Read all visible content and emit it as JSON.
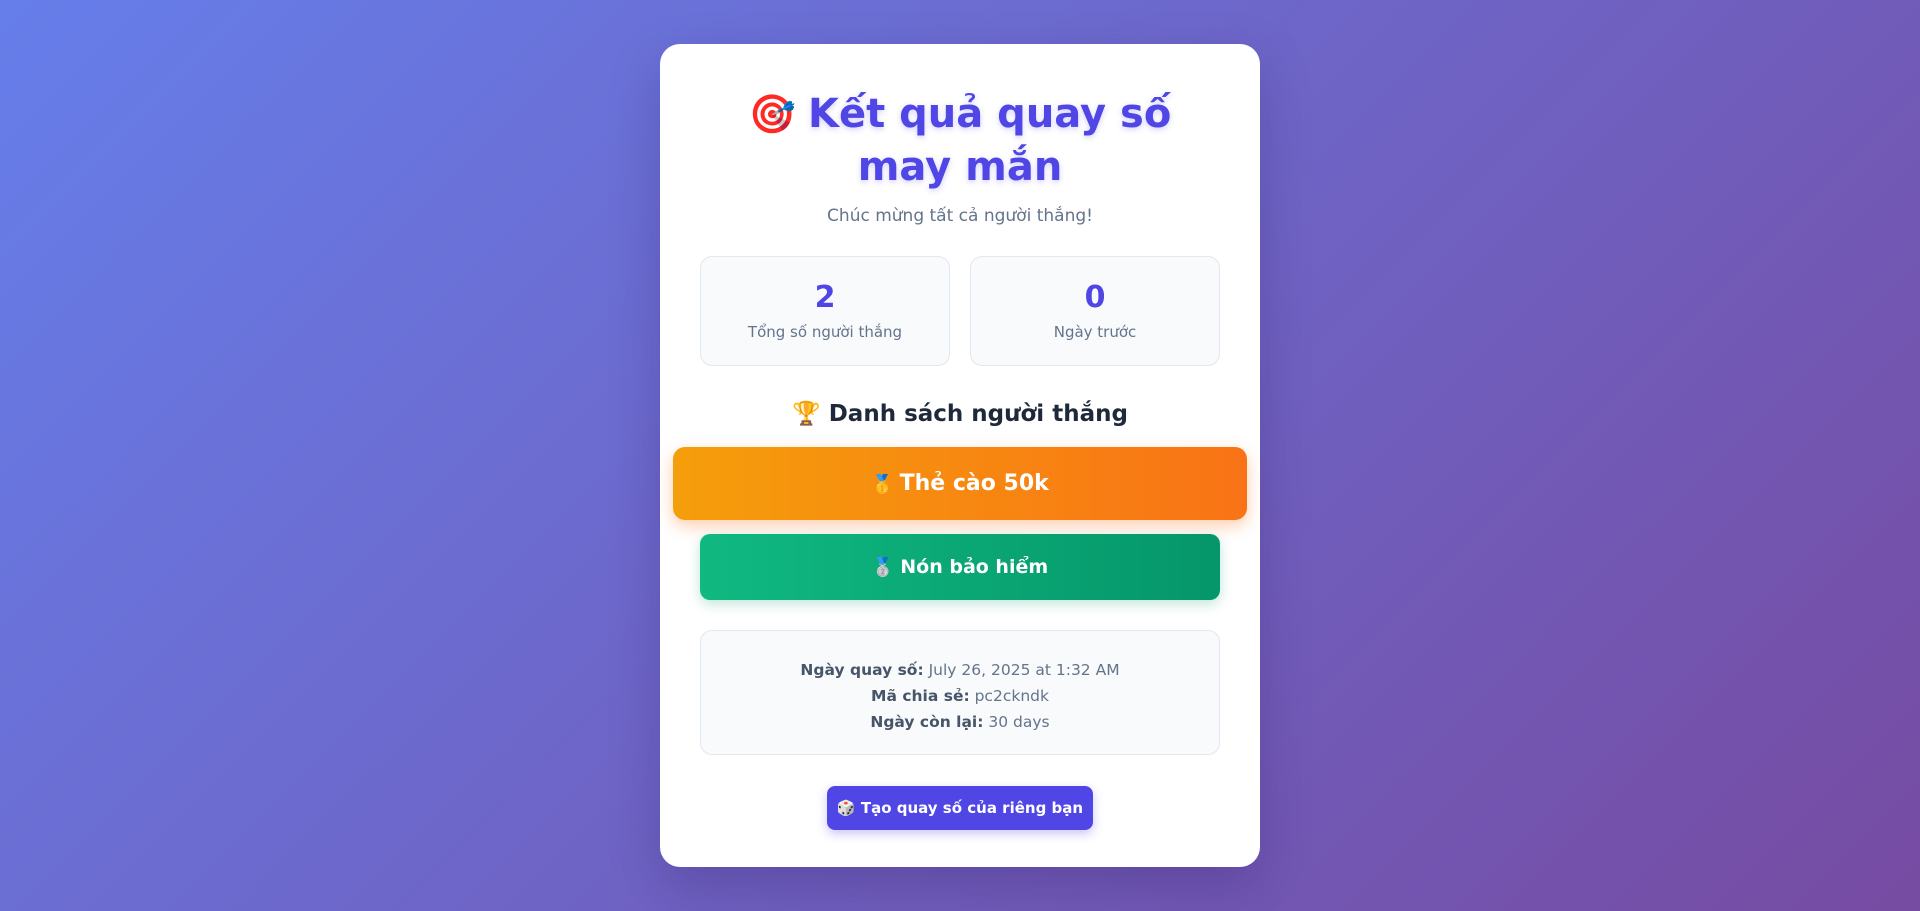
{
  "header": {
    "icon": "🎯",
    "title": "Kết quả quay số may mắn",
    "subtitle": "Chúc mừng tất cả người thắng!"
  },
  "stats": [
    {
      "value": "2",
      "label": "Tổng số người thắng"
    },
    {
      "value": "0",
      "label": "Ngày trước"
    }
  ],
  "winners_section": {
    "icon": "🏆",
    "title": "Danh sách người thắng"
  },
  "winners": [
    {
      "medal": "🥇",
      "label": "Thẻ cào 50k"
    },
    {
      "medal": "🥈",
      "label": "Nón bảo hiểm"
    }
  ],
  "info": {
    "date_label": "Ngày quay số:",
    "date_value": "July 26, 2025 at 1:32 AM",
    "share_label": "Mã chia sẻ:",
    "share_value": "pc2ckndk",
    "remaining_label": "Ngày còn lại:",
    "remaining_value": "30 days"
  },
  "cta": {
    "icon": "🎲",
    "label": "Tạo quay số của riêng bạn"
  },
  "colors": {
    "accent": "#4f46e5",
    "gold_start": "#f59e0b",
    "gold_end": "#f97316",
    "green_start": "#10b981",
    "green_end": "#059669"
  }
}
